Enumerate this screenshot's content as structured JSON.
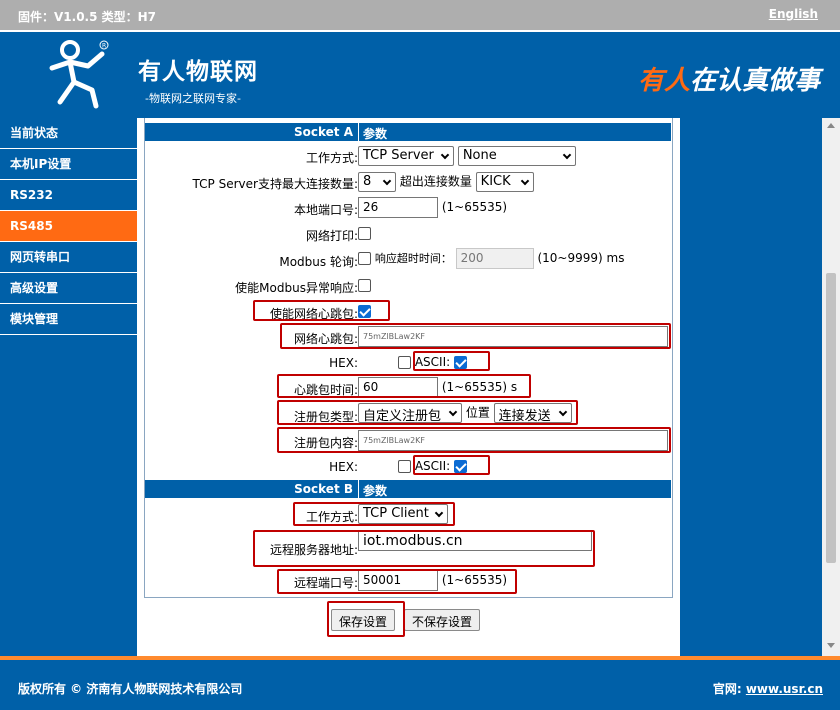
{
  "topbar": {
    "firmware": "固件：V1.0.5 类型：H7",
    "lang": "English"
  },
  "brand": {
    "name": "有人物联网",
    "sub": "-物联网之联网专家-",
    "slogan1": "有人",
    "slogan2": "在认真做事"
  },
  "colors": {
    "primary": "#0060a8",
    "accent": "#ff6a13",
    "highlight": "#c00000"
  },
  "sidebar": {
    "items": [
      {
        "label": "当前状态"
      },
      {
        "label": "本机IP设置"
      },
      {
        "label": "RS232"
      },
      {
        "label": "RS485",
        "active": true
      },
      {
        "label": "网页转串口"
      },
      {
        "label": "高级设置"
      },
      {
        "label": "模块管理"
      }
    ]
  },
  "socketA": {
    "title": "Socket A",
    "params": "参数",
    "mode_label": "工作方式:",
    "mode_value": "TCP Server",
    "mode2_value": "None",
    "maxconn_label": "TCP Server支持最大连接数量:",
    "maxconn_value": "8",
    "exceed_label": "超出连接数量",
    "exceed_value": "KICK",
    "localport_label": "本地端口号:",
    "localport_value": "26",
    "localport_range": "(1~65535)",
    "netprint_label": "网络打印:",
    "modbus_label": "Modbus 轮询:",
    "timeout_label": "响应超时时间：",
    "timeout_value": "200",
    "timeout_range": "(10~9999) ms",
    "modbus_exc_label": "使能Modbus异常响应:",
    "heartbeat_en_label": "使能网络心跳包:",
    "heartbeat_label": "网络心跳包:",
    "heartbeat_value": "75mZlBLaw2KF",
    "hex_label": "HEX:",
    "ascii_label": "ASCII:",
    "hb_time_label": "心跳包时间:",
    "hb_time_value": "60",
    "hb_time_range": "(1~65535) s",
    "reg_type_label": "注册包类型:",
    "reg_type_value": "自定义注册包",
    "position_label": "位置",
    "position_value": "连接发送",
    "reg_content_label": "注册包内容:",
    "reg_content_value": "75mZlBLaw2KF"
  },
  "socketB": {
    "title": "Socket B",
    "params": "参数",
    "mode_label": "工作方式:",
    "mode_value": "TCP Client",
    "server_label": "远程服务器地址:",
    "server_value": "iot.modbus.cn",
    "port_label": "远程端口号:",
    "port_value": "50001",
    "port_range": "(1~65535)"
  },
  "buttons": {
    "save": "保存设置",
    "nosave": "不保存设置"
  },
  "footer": {
    "copyright": "版权所有 © 济南有人物联网技术有限公司",
    "site_label": "官网:",
    "site_url": "www.usr.cn"
  }
}
